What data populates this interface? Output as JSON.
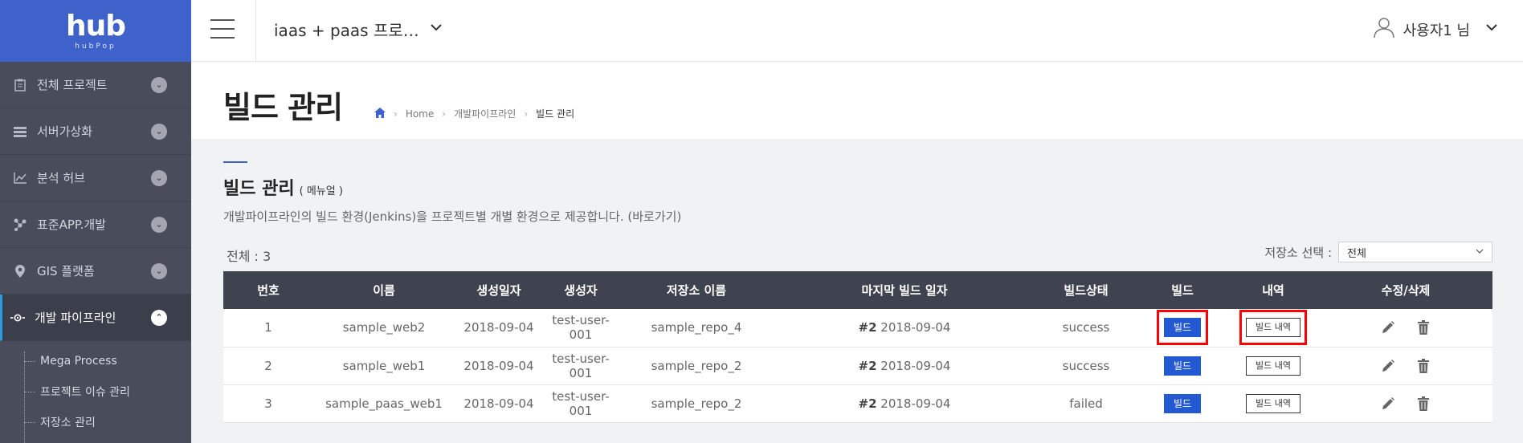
{
  "app": {
    "logo_text": "hub",
    "logo_sub": "hubPop"
  },
  "header": {
    "project_name": "iaas + paas 프로…",
    "user_label": "사용자1 님"
  },
  "sidebar": {
    "items": [
      {
        "label": "전체 프로젝트",
        "icon": "clipboard-icon"
      },
      {
        "label": "서버가상화",
        "icon": "server-icon"
      },
      {
        "label": "분석 허브",
        "icon": "chart-icon"
      },
      {
        "label": "표준APP.개발",
        "icon": "nodes-icon"
      },
      {
        "label": "GIS 플랫폼",
        "icon": "map-pin-icon"
      },
      {
        "label": "개발 파이프라인",
        "icon": "pipeline-icon"
      }
    ],
    "sub_items": [
      {
        "label": "Mega Process"
      },
      {
        "label": "프로젝트 이슈 관리"
      },
      {
        "label": "저장소 관리"
      }
    ]
  },
  "page": {
    "title": "빌드 관리",
    "breadcrumb": [
      "Home",
      "개발파이프라인",
      "빌드 관리"
    ]
  },
  "section": {
    "title": "빌드 관리",
    "manual": "( 메뉴얼 )",
    "description": "개발파이프라인의 빌드 환경(Jenkins)을 프로젝트별 개별 환경으로 제공합니다. (바로가기)",
    "total": "전체 : 3",
    "repo_filter_label": "저장소 선택 :",
    "repo_filter_value": "전체"
  },
  "table": {
    "headers": [
      "번호",
      "이름",
      "생성일자",
      "생성자",
      "저장소 이름",
      "마지막 빌드 일자",
      "빌드상태",
      "빌드",
      "내역",
      "수정/삭제"
    ],
    "rows": [
      {
        "no": "1",
        "name": "sample_web2",
        "created": "2018-09-04",
        "creator": "test-user-001",
        "repo": "sample_repo_4",
        "build_no": "#2",
        "last_build": "2018-09-04",
        "status": "success"
      },
      {
        "no": "2",
        "name": "sample_web1",
        "created": "2018-09-04",
        "creator": "test-user-001",
        "repo": "sample_repo_2",
        "build_no": "#2",
        "last_build": "2018-09-04",
        "status": "success"
      },
      {
        "no": "3",
        "name": "sample_paas_web1",
        "created": "2018-09-04",
        "creator": "test-user-001",
        "repo": "sample_repo_2",
        "build_no": "#2",
        "last_build": "2018-09-04",
        "status": "failed"
      }
    ],
    "build_button": "빌드",
    "history_button": "빌드 내역"
  },
  "colors": {
    "brand": "#3e62c9",
    "sidebar_bg": "#484c5b",
    "table_header": "#3f424f",
    "build_button": "#2459d4",
    "highlight": "#ff0000"
  }
}
